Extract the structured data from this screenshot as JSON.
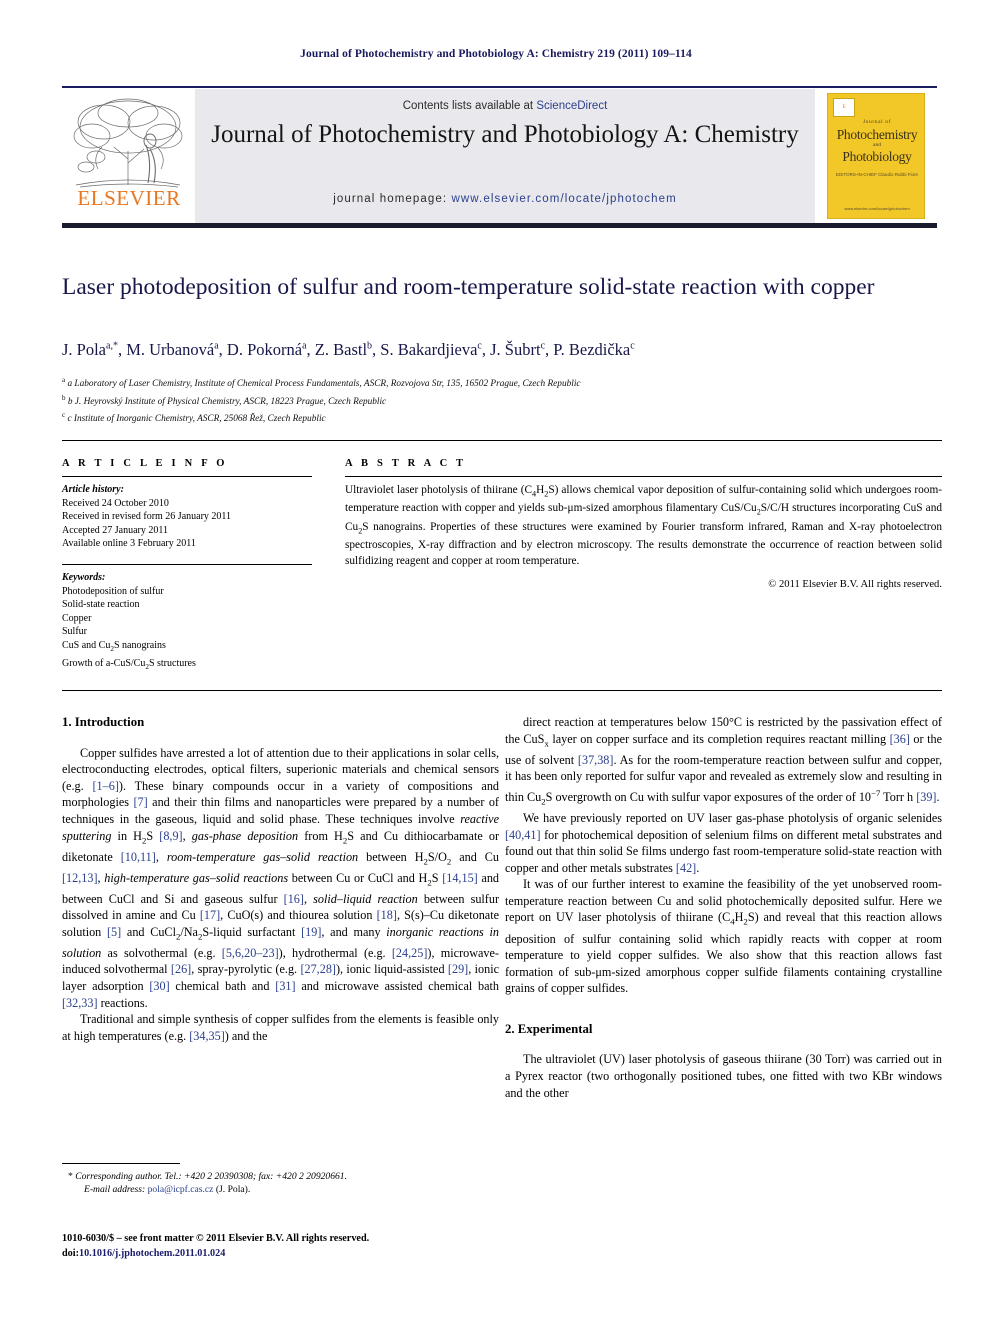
{
  "running_head": "Journal of Photochemistry and Photobiology A: Chemistry 219 (2011) 109–114",
  "masthead": {
    "contents_prefix": "Contents lists available at ",
    "contents_link": "ScienceDirect",
    "journal_title": "Journal of Photochemistry and Photobiology A: Chemistry",
    "homepage_prefix": "journal homepage: ",
    "homepage_url": "www.elsevier.com/locate/jphotochem",
    "publisher_logo_text": "ELSEVIER",
    "publisher_color": "#e87722",
    "cover": {
      "journal_of": "Journal of",
      "line1": "Photochemistry",
      "and": "and",
      "line2": "Photobiology",
      "editors": "EDITORS-IN-CHIEF\nClaudio Rubbi Fiore",
      "url": "www.elsevier.com/locate/jphotochem",
      "background_color": "#f2c829"
    }
  },
  "article": {
    "title": "Laser photodeposition of sulfur and room-temperature solid-state reaction with copper",
    "authors_html": "J. Pola<sup>a,*</sup>, M. Urbanová<sup>a</sup>, D. Pokorná<sup>a</sup>, Z. Bastl<sup>b</sup>, S. Bakardjieva<sup>c</sup>, J. Šubrt<sup>c</sup>, P. Bezdička<sup>c</sup>",
    "affiliations": [
      "a Laboratory of Laser Chemistry, Institute of Chemical Process Fundamentals, ASCR, Rozvojova Str, 135, 16502 Prague, Czech Republic",
      "b J. Heyrovský Institute of Physical Chemistry, ASCR, 18223 Prague, Czech Republic",
      "c Institute of Inorganic Chemistry, ASCR, 25068 Řež, Czech Republic"
    ]
  },
  "article_info": {
    "heading": "A R T I C L E   I N F O",
    "history_label": "Article history:",
    "history": [
      "Received 24 October 2010",
      "Received in revised form 26 January 2011",
      "Accepted 27 January 2011",
      "Available online 3 February 2011"
    ],
    "keywords_label": "Keywords:",
    "keywords": [
      "Photodeposition of sulfur",
      "Solid-state reaction",
      "Copper",
      "Sulfur",
      "CuS and Cu2S nanograins",
      "Growth of a-CuS/Cu2S structures"
    ]
  },
  "abstract": {
    "heading": "A B S T R A C T",
    "text_html": "Ultraviolet laser photolysis of thiirane (C<sub>4</sub>H<sub>2</sub>S) allows chemical vapor deposition of sulfur-containing solid which undergoes room-temperature reaction with copper and yields sub-&mu;m-sized amorphous filamentary CuS/Cu<sub>2</sub>S/C/H structures incorporating CuS and Cu<sub>2</sub>S nanograins. Properties of these structures were examined by Fourier transform infrared, Raman and X-ray photoelectron spectroscopies, X-ray diffraction and by electron microscopy. The results demonstrate the occurrence of reaction between solid sulfidizing reagent and copper at room temperature.",
    "copyright": "© 2011 Elsevier B.V. All rights reserved."
  },
  "body": {
    "section1_heading": "1.  Introduction",
    "left_p1_html": "Copper sulfides have arrested a lot of attention due to their applications in solar cells, electroconducting electrodes, optical filters, superionic materials and chemical sensors (e.g. <span class=\"ref\">[1–6]</span>). These binary compounds occur in a variety of compositions and morphologies <span class=\"ref\">[7]</span> and their thin films and nanoparticles were prepared by a number of techniques in the gaseous, liquid and solid phase. These techniques involve <span class=\"it\">reactive sputtering</span> in H<sub>2</sub>S <span class=\"ref\">[8,9]</span>, <span class=\"it\">gas-phase deposition</span> from H<sub>2</sub>S and Cu dithiocarbamate or diketonate <span class=\"ref\">[10,11]</span>, <span class=\"it\">room-temperature gas–solid reaction</span> between H<sub>2</sub>S/O<sub>2</sub> and Cu <span class=\"ref\">[12,13]</span>, <span class=\"it\">high-temperature gas–solid reactions</span> between Cu or CuCl and H<sub>2</sub>S <span class=\"ref\">[14,15]</span> and between CuCl and Si and gaseous sulfur <span class=\"ref\">[16]</span>, <span class=\"it\">solid–liquid reaction</span> between sulfur dissolved in amine and Cu <span class=\"ref\">[17]</span>, CuO(s) and thiourea solution <span class=\"ref\">[18]</span>, S(s)–Cu diketonate solution <span class=\"ref\">[5]</span> and CuCl<sub>2</sub>/Na<sub>2</sub>S-liquid surfactant <span class=\"ref\">[19]</span>, and many <span class=\"it\">inorganic reactions in solution</span> as solvothermal (e.g. <span class=\"ref\">[5,6,20–23]</span>), hydrothermal (e.g. <span class=\"ref\">[24,25]</span>), microwave-induced solvothermal <span class=\"ref\">[26]</span>, spray-pyrolytic (e.g. <span class=\"ref\">[27,28]</span>), ionic liquid-assisted <span class=\"ref\">[29]</span>, ionic layer adsorption <span class=\"ref\">[30]</span> chemical bath and <span class=\"ref\">[31]</span> and microwave assisted chemical bath <span class=\"ref\">[32,33]</span> reactions.",
    "left_p2_html": "Traditional and simple synthesis of copper sulfides from the elements is feasible only at high temperatures (e.g. <span class=\"ref\">[34,35]</span>) and the",
    "right_p1_html": "direct reaction at temperatures below 150&deg;C is restricted by the passivation effect of the CuS<sub>x</sub> layer on copper surface and its completion requires reactant milling <span class=\"ref\">[36]</span> or the use of solvent <span class=\"ref\">[37,38]</span>. As for the room-temperature reaction between sulfur and copper, it has been only reported for sulfur vapor and revealed as extremely slow and resulting in thin Cu<sub>2</sub>S overgrowth on Cu with sulfur vapor exposures of the order of 10<sup class=\"n\">−7</sup> Torr h <span class=\"ref\">[39]</span>.",
    "right_p2_html": "We have previously reported on UV laser gas-phase photolysis of organic selenides <span class=\"ref\">[40,41]</span> for photochemical deposition of selenium films on different metal substrates and found out that thin solid Se films undergo fast room-temperature solid-state reaction with copper and other metals substrates <span class=\"ref\">[42]</span>.",
    "right_p3_html": "It was of our further interest to examine the feasibility of the yet unobserved room-temperature reaction between Cu and solid photochemically deposited sulfur. Here we report on UV laser photolysis of thiirane (C<sub>4</sub>H<sub>2</sub>S) and reveal that this reaction allows deposition of sulfur containing solid which rapidly reacts with copper at room temperature to yield copper sulfides. We also show that this reaction allows fast formation of sub-&mu;m-sized amorphous copper sulfide filaments containing crystalline grains of copper sulfides.",
    "section2_heading": "2.  Experimental",
    "right_p4_html": "The ultraviolet (UV) laser photolysis of gaseous thiirane (30 Torr) was carried out in a Pyrex reactor (two orthogonally positioned tubes, one fitted with two KBr windows and the other"
  },
  "footnotes": {
    "corresponding_html": "* <span class=\"em\">Corresponding author. Tel.: +420 2 20390308; fax: +420 2 20920661.</span>",
    "email_label": "E-mail address:",
    "email": "pola@icpf.cas.cz",
    "email_attrib": "(J. Pola).",
    "imprint_line1": "1010-6030/$ – see front matter © 2011 Elsevier B.V. All rights reserved.",
    "imprint_doi_label": "doi:",
    "imprint_doi": "10.1016/j.jphotochem.2011.01.024"
  }
}
